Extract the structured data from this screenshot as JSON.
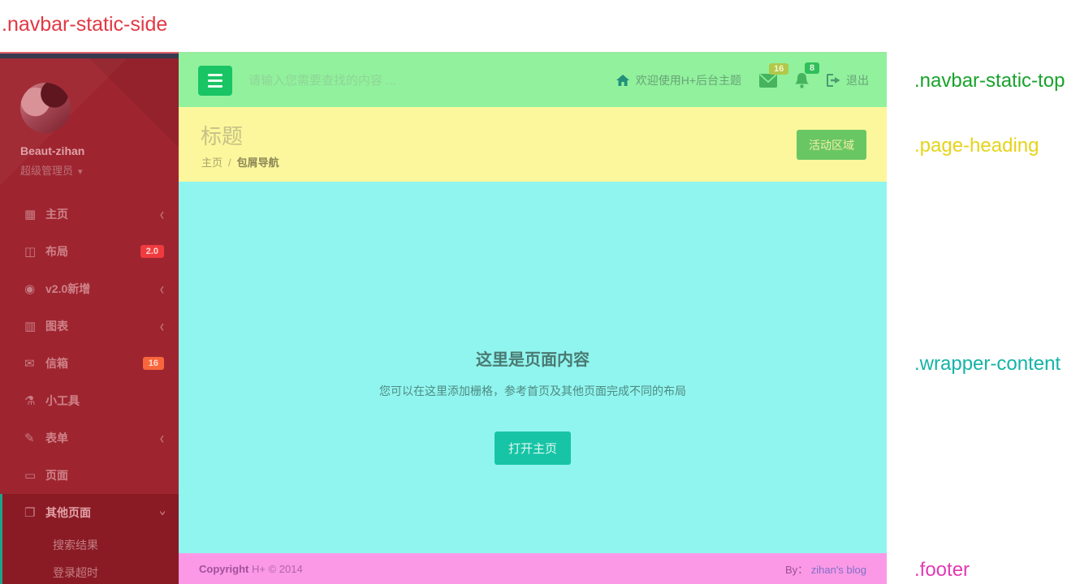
{
  "annotations": {
    "side": {
      "text": ".navbar-static-side",
      "color": "#e23844"
    },
    "top": {
      "text": ".navbar-static-top",
      "color": "#18a32b"
    },
    "heading": {
      "text": ".page-heading",
      "color": "#e6d419"
    },
    "content": {
      "text": ".wrapper-content",
      "color": "#14b4a6"
    },
    "footer": {
      "text": ".footer",
      "color": "#e23ab5"
    }
  },
  "sidebar": {
    "profile": {
      "name": "Beaut-zihan",
      "role": "超级管理员",
      "caret": "▾"
    },
    "items": [
      {
        "name": "home",
        "label": "主页",
        "icon": "th-large",
        "chevron": "left"
      },
      {
        "name": "layouts",
        "label": "布局",
        "icon": "columns",
        "badge": "2.0",
        "badge_color": "#ef3b3f"
      },
      {
        "name": "v2-new",
        "label": "v2.0新增",
        "icon": "globe",
        "chevron": "left"
      },
      {
        "name": "charts",
        "label": "图表",
        "icon": "bar-chart",
        "chevron": "left"
      },
      {
        "name": "mailbox",
        "label": "信箱",
        "icon": "envelope",
        "badge": "16",
        "badge_color": "#f8673c"
      },
      {
        "name": "widgets",
        "label": "小工具",
        "icon": "flask"
      },
      {
        "name": "forms",
        "label": "表单",
        "icon": "edit",
        "chevron": "left"
      },
      {
        "name": "pages",
        "label": "页面",
        "icon": "desktop"
      },
      {
        "name": "other-pages",
        "label": "其他页面",
        "icon": "copy",
        "chevron": "down",
        "active": true,
        "children": [
          {
            "name": "search-results",
            "label": "搜索结果"
          },
          {
            "name": "login-timeout",
            "label": "登录超时"
          }
        ]
      }
    ]
  },
  "topbar": {
    "search_placeholder": "请输入您需要查找的内容 ...",
    "welcome_text": "欢迎使用H+后台主题",
    "mail_badge": "16",
    "mail_badge_bg": "#b0c94a",
    "mail_badge_fg": "#f3f7cd",
    "alert_badge": "8",
    "alert_badge_bg": "#2fbf5c",
    "alert_badge_fg": "#e3f8da",
    "logout_label": "退出"
  },
  "page_heading": {
    "title": "标题",
    "breadcrumb": {
      "root": "主页",
      "separator": "/",
      "current": "包屑导航"
    },
    "action_button": "活动区域"
  },
  "content": {
    "title": "这里是页面内容",
    "subtitle": "您可以在这里添加栅格，参考首页及其他页面完成不同的布局",
    "button": "打开主页"
  },
  "footer": {
    "copyright_strong": "Copyright",
    "copyright_rest": " H+ © 2014",
    "by_label": "By：",
    "by_link": "zihan's blog"
  }
}
